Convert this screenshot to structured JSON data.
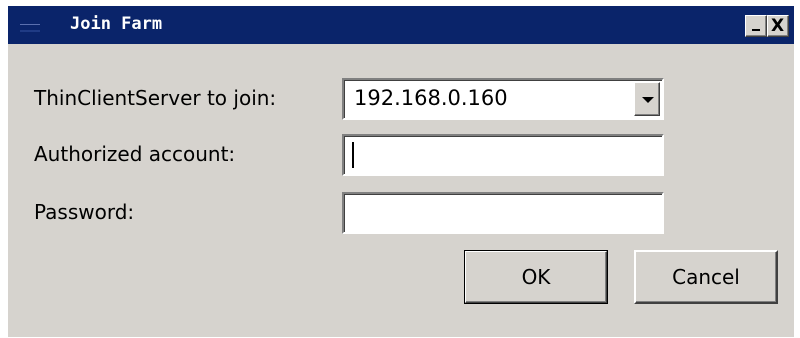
{
  "window": {
    "title": "Join Farm",
    "controls": {
      "minimize_icon": "minimize-icon",
      "close_label": "X"
    }
  },
  "form": {
    "server_label": "ThinClientServer to join:",
    "server_value": "192.168.0.160",
    "account_label": "Authorized account:",
    "account_value": "",
    "password_label": "Password:",
    "password_value": ""
  },
  "buttons": {
    "ok_label": "OK",
    "cancel_label": "Cancel"
  },
  "colors": {
    "titlebar": "#0a246a",
    "face": "#d6d3ce"
  }
}
